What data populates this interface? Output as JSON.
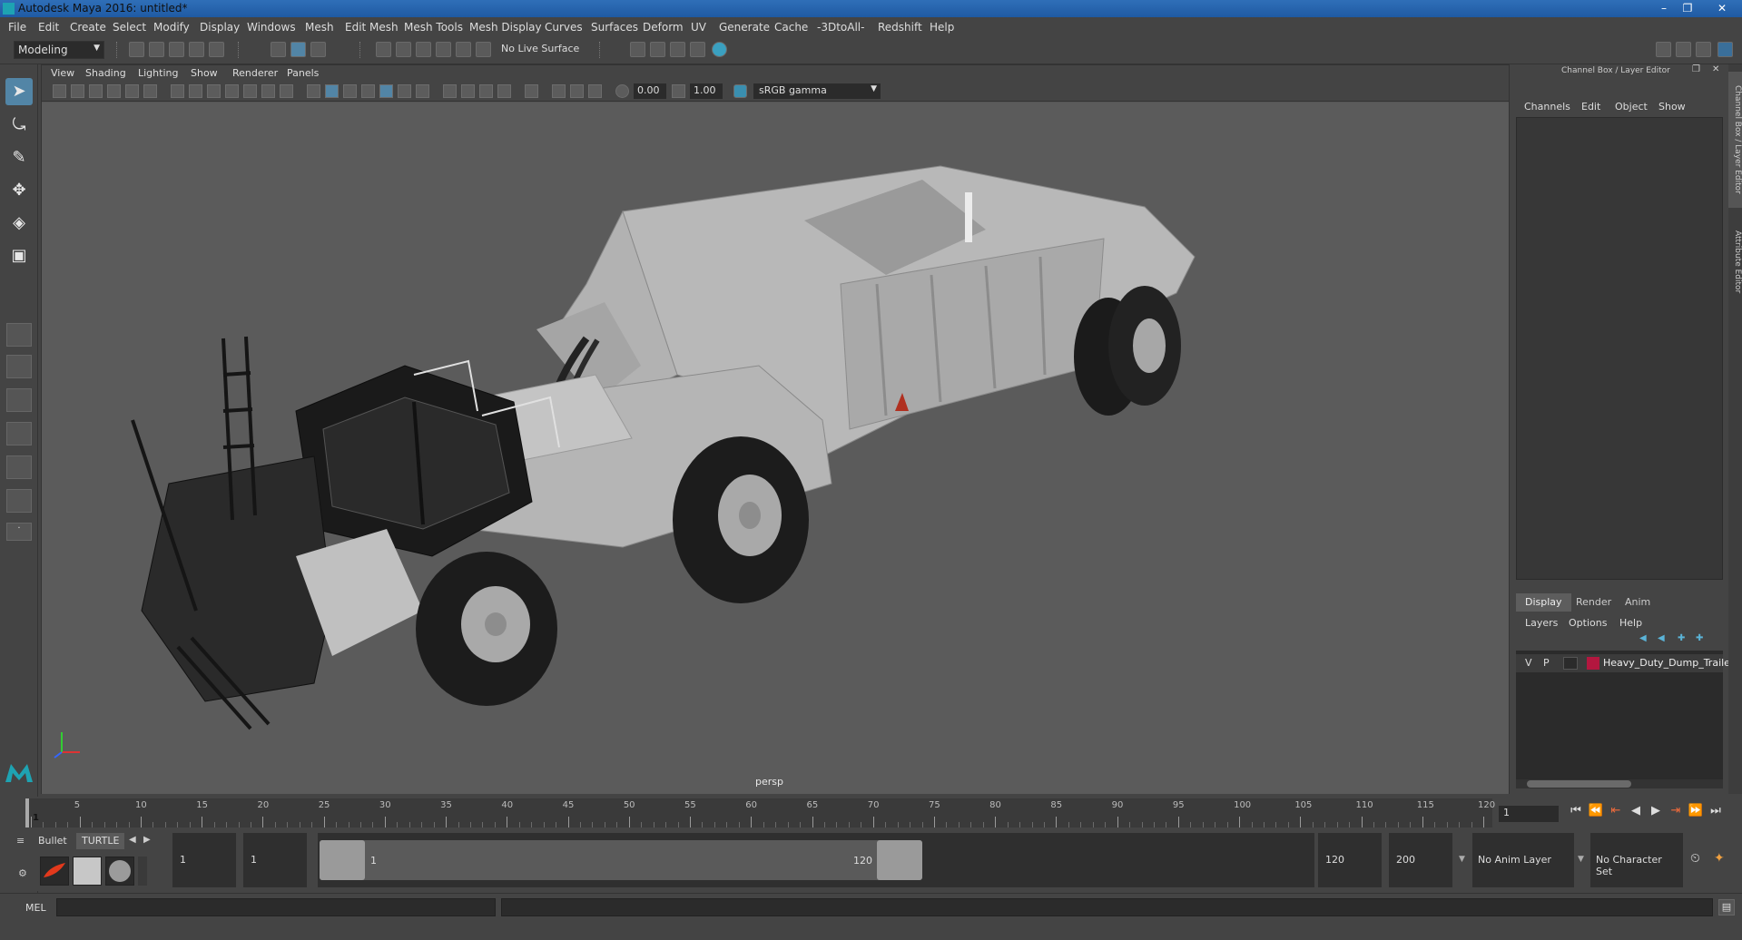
{
  "window": {
    "title": "Autodesk Maya 2016: untitled*",
    "min": "–",
    "max": "❐",
    "close": "✕"
  },
  "menubar": [
    "File",
    "Edit",
    "Create",
    "Select",
    "Modify",
    "Display",
    "Windows",
    "Mesh",
    "Edit Mesh",
    "Mesh Tools",
    "Mesh Display",
    "Curves",
    "Surfaces",
    "Deform",
    "UV",
    "Generate",
    "Cache",
    "-3DtoAll-",
    "Redshift",
    "Help"
  ],
  "statusline": {
    "mode": "Modeling",
    "live_surface": "No Live Surface"
  },
  "panel": {
    "menus": [
      "View",
      "Shading",
      "Lighting",
      "Show",
      "Renderer",
      "Panels"
    ],
    "exposure": "0.00",
    "gamma": "1.00",
    "color_space": "sRGB gamma",
    "camera": "persp"
  },
  "channelbox": {
    "title": "Channel Box / Layer Editor",
    "menus": [
      "Channels",
      "Edit",
      "Object",
      "Show"
    ],
    "layer_tabs": [
      "Display",
      "Render",
      "Anim"
    ],
    "layer_menus": [
      "Layers",
      "Options",
      "Help"
    ],
    "layers": [
      {
        "v": "V",
        "p": "P",
        "name": "Heavy_Duty_Dump_Traile",
        "color": "#b3173f"
      }
    ]
  },
  "side_tabs": [
    "Channel Box / Layer Editor",
    "Attribute Editor"
  ],
  "timeline": {
    "ticks": [
      "1",
      "5",
      "10",
      "15",
      "20",
      "25",
      "30",
      "35",
      "40",
      "45",
      "50",
      "55",
      "60",
      "65",
      "70",
      "75",
      "80",
      "85",
      "90",
      "95",
      "100",
      "105",
      "110",
      "115",
      "120"
    ],
    "current_frame": "1"
  },
  "range": {
    "shelf_tabs": [
      "Bullet",
      "TURTLE"
    ],
    "start": "1",
    "playback_start": "1",
    "slider_start": "1",
    "slider_end": "120",
    "playback_end": "120",
    "end": "200",
    "anim_layer": "No Anim Layer",
    "character_set": "No Character Set"
  },
  "cmdline": {
    "label": "MEL"
  }
}
